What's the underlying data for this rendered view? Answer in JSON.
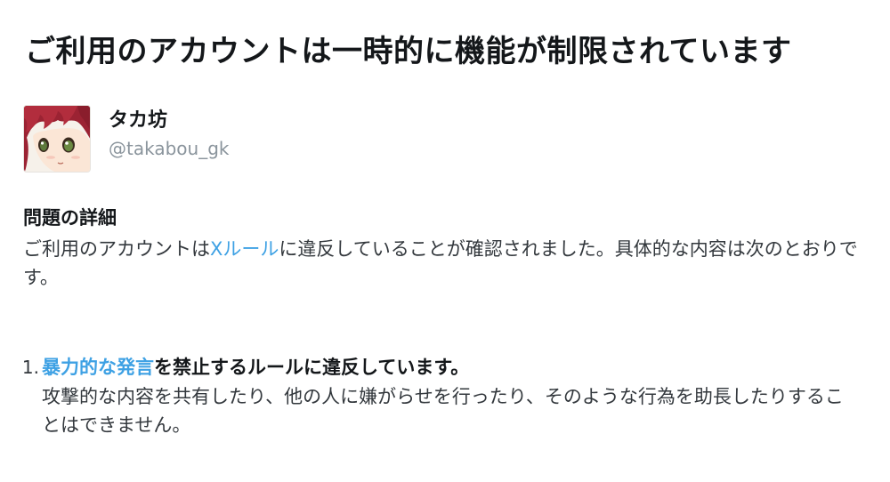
{
  "title": "ご利用のアカウントは一時的に機能が制限されています",
  "account": {
    "display_name": "タカ坊",
    "handle": "@takabou_gk"
  },
  "details": {
    "heading": "問題の詳細",
    "text_before_link": "ご利用のアカウントは",
    "link_text": "Xルール",
    "text_after_link": "に違反していることが確認されました。具体的な内容は次のとおりです。"
  },
  "violations": [
    {
      "number": "1.",
      "link_text": "暴力的な発言",
      "title_rest": "を禁止するルールに違反しています。",
      "description": "攻撃的な内容を共有したり、他の人に嫌がらせを行ったり、そのような行為を助長したりすることはできません。"
    }
  ],
  "colors": {
    "link": "#3ea1e4",
    "text": "#14171a",
    "secondary": "#8a949c"
  },
  "icons": {
    "avatar": "anime-avatar"
  }
}
